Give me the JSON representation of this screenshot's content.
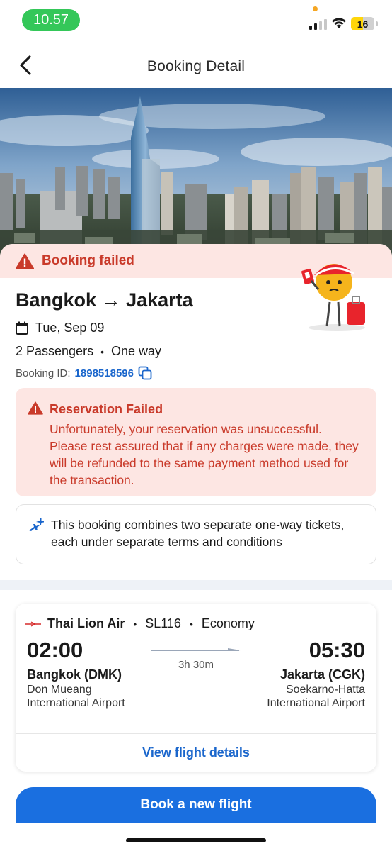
{
  "status_bar": {
    "time": "10.57",
    "battery_level": "16"
  },
  "header": {
    "title": "Booking Detail"
  },
  "booking": {
    "status_banner": "Booking failed",
    "route_from": "Bangkok",
    "route_arrow": "→",
    "route_to": "Jakarta",
    "date": "Tue, Sep 09",
    "passengers": "2 Passengers",
    "separator": "•",
    "trip_type": "One way",
    "booking_id_label": "Booking ID:",
    "booking_id": "1898518596"
  },
  "alert": {
    "title": "Reservation Failed",
    "message": "Unfortunately, your reservation was unsuccessful. Please rest assured that if any charges were made, they will be refunded to the same payment method used for the transaction."
  },
  "info": {
    "message": "This booking combines two separate one-way tickets, each under separate terms and conditions"
  },
  "flight": {
    "airline": "Thai Lion Air",
    "flight_number": "SL116",
    "cabin": "Economy",
    "dot": "•",
    "departure_time": "02:00",
    "arrival_time": "05:30",
    "duration": "3h 30m",
    "departure_code": "Bangkok (DMK)",
    "arrival_code": "Jakarta (CGK)",
    "departure_airport": "Don Mueang International Airport",
    "arrival_airport": "Soekarno-Hatta International Airport",
    "view_details_label": "View flight details"
  },
  "cta": {
    "label": "Book a new flight"
  },
  "colors": {
    "accent": "#1a6fe0",
    "error": "#c93a2a",
    "error_bg": "#fde6e3",
    "status_green": "#34c759"
  },
  "icons": [
    "back-arrow-icon",
    "warning-icon",
    "calendar-icon",
    "copy-icon",
    "airplanes-icon",
    "airline-logo-icon",
    "signal-icon",
    "wifi-icon",
    "battery-icon"
  ]
}
